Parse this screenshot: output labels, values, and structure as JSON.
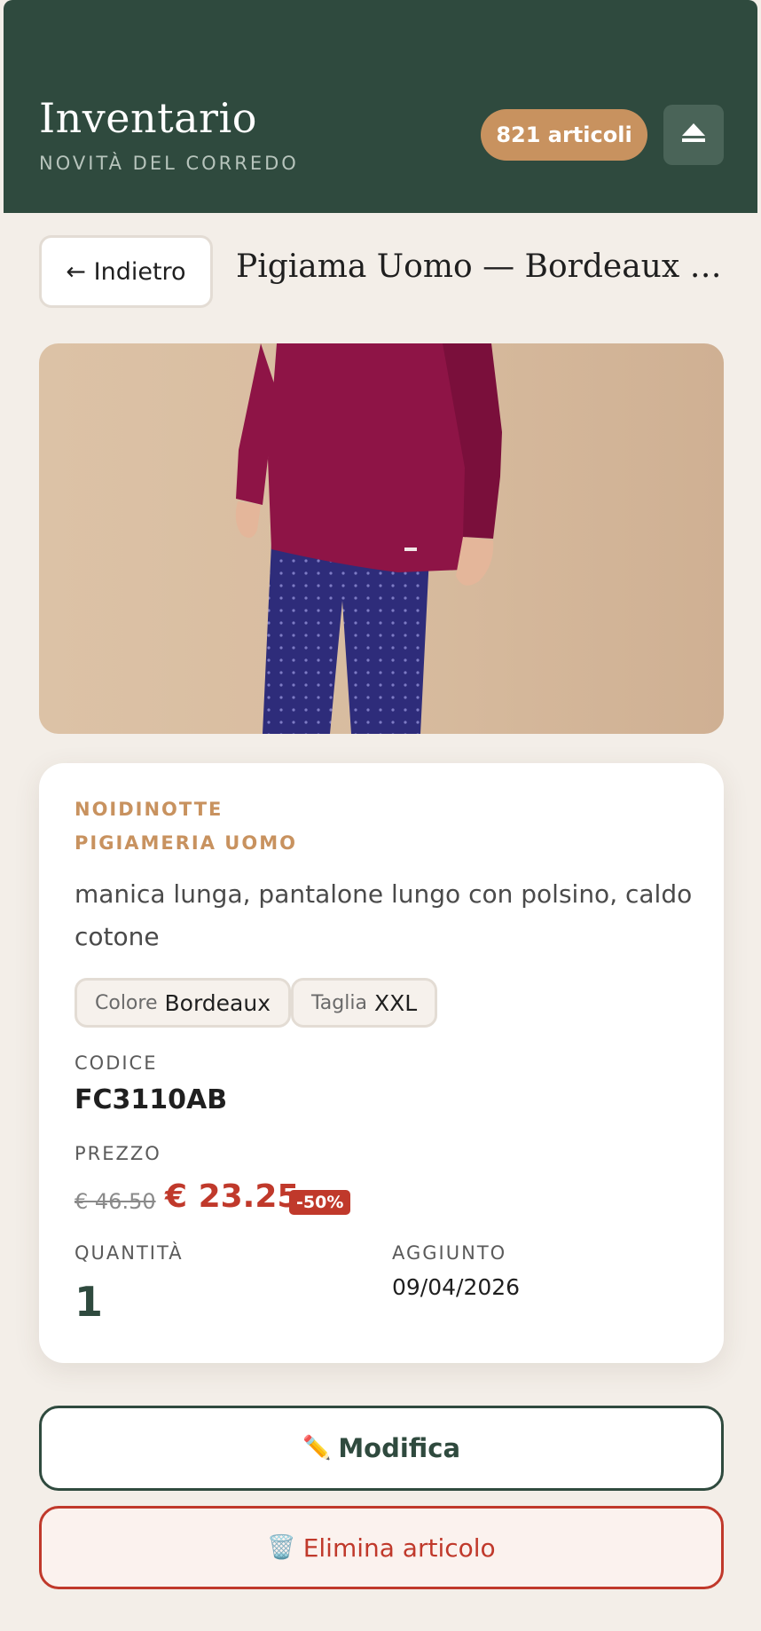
{
  "header": {
    "title": "Inventario",
    "subtitle": "NOVITÀ DEL CORREDO",
    "count_label": "821 articoli",
    "eject_icon": "eject-icon"
  },
  "nav": {
    "back_label": "← Indietro",
    "product_title": "Pigiama Uomo — Bordeaux — XXL"
  },
  "photo": {
    "description_icon": "product-photo",
    "background_color": "#d8bc9f",
    "shirt_color": "#8e1446",
    "pants_color": "#2e2c7a"
  },
  "product": {
    "brand": "NOIDINOTTE",
    "category": "PIGIAMERIA UOMO",
    "description": "manica lunga, pantalone lungo con polsino, caldo cotone",
    "attributes": [
      {
        "key": "Colore",
        "value": "Bordeaux"
      },
      {
        "key": "Taglia",
        "value": "XXL"
      }
    ],
    "code_label": "CODICE",
    "code": "FC3110AB",
    "price_label": "PREZZO",
    "old_price": "€ 46.50",
    "new_price": "€ 23.25",
    "discount": "-50%",
    "quantity_label": "QUANTITÀ",
    "quantity": "1",
    "added_label": "AGGIUNTO",
    "added_date": "09/04/2026"
  },
  "actions": {
    "edit_icon": "✏️",
    "edit_label": "Modifica",
    "delete_icon": "🗑️",
    "delete_label": "Elimina articolo"
  },
  "colors": {
    "header_bg": "#2f4a3e",
    "accent": "#c8925f",
    "danger": "#c0392b",
    "page_bg": "#f3eee8"
  }
}
